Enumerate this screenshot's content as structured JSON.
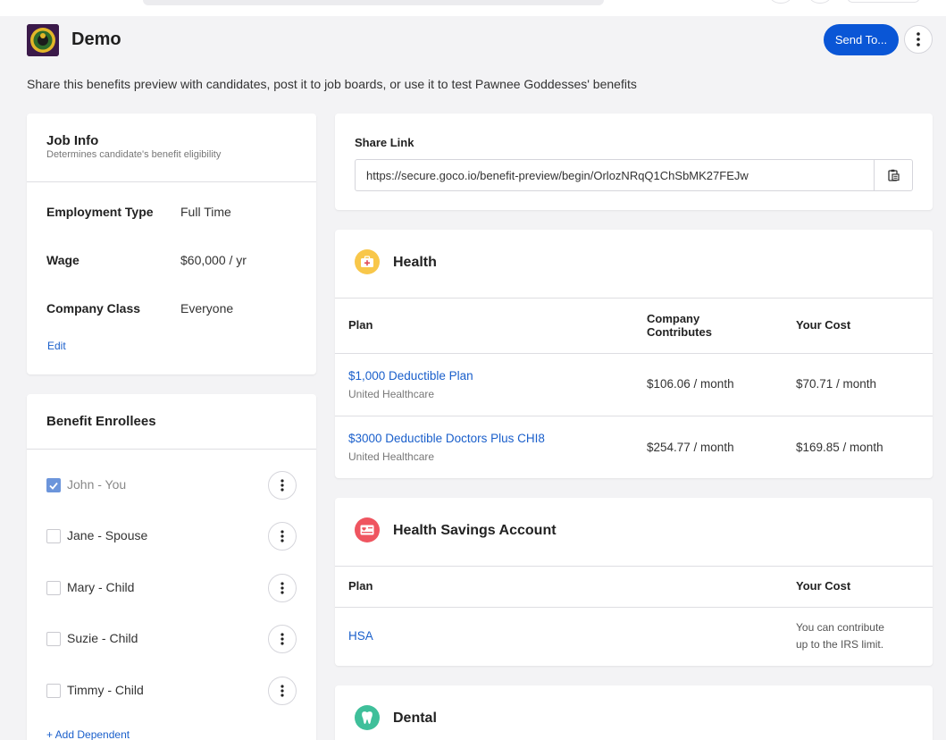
{
  "header": {
    "title": "Demo",
    "send_button": "Send To...",
    "subtitle": "Share this benefits preview with candidates, post it to job boards, or use it to test Pawnee Goddesses' benefits"
  },
  "job_info": {
    "title": "Job Info",
    "subtitle": "Determines candidate's benefit eligibility",
    "rows": [
      {
        "label": "Employment Type",
        "value": "Full Time"
      },
      {
        "label": "Wage",
        "value": "$60,000 / yr"
      },
      {
        "label": "Company Class",
        "value": "Everyone"
      }
    ],
    "edit_link": "Edit"
  },
  "enrollees": {
    "title": "Benefit Enrollees",
    "items": [
      {
        "name": "John - You",
        "checked": true
      },
      {
        "name": "Jane - Spouse",
        "checked": false
      },
      {
        "name": "Mary - Child",
        "checked": false
      },
      {
        "name": "Suzie - Child",
        "checked": false
      },
      {
        "name": "Timmy - Child",
        "checked": false
      }
    ],
    "add_link": "+ Add Dependent"
  },
  "share": {
    "label": "Share Link",
    "url": "https://secure.goco.io/benefit-preview/begin/OrlozNRqQ1ChSbMK27FEJw"
  },
  "health": {
    "title": "Health",
    "headers": {
      "plan": "Plan",
      "company_line1": "Company",
      "company_line2": "Contributes",
      "cost": "Your Cost"
    },
    "plans": [
      {
        "name": "$1,000 Deductible Plan",
        "carrier": "United Healthcare",
        "company": "$106.06 / month",
        "cost": "$70.71 / month"
      },
      {
        "name": "$3000 Deductible Doctors Plus CHI8",
        "carrier": "United Healthcare",
        "company": "$254.77 / month",
        "cost": "$169.85 / month"
      }
    ]
  },
  "hsa": {
    "title": "Health Savings Account",
    "headers": {
      "plan": "Plan",
      "cost": "Your Cost"
    },
    "plan": "HSA",
    "note_line1": "You can contribute",
    "note_line2": "up to the IRS limit."
  },
  "dental": {
    "title": "Dental"
  },
  "colors": {
    "primary": "#0a56d6",
    "link": "#1a5fcb",
    "health_icon": "#f8c74a",
    "hsa_icon": "#ef5560",
    "dental_icon": "#3fbf9a"
  }
}
